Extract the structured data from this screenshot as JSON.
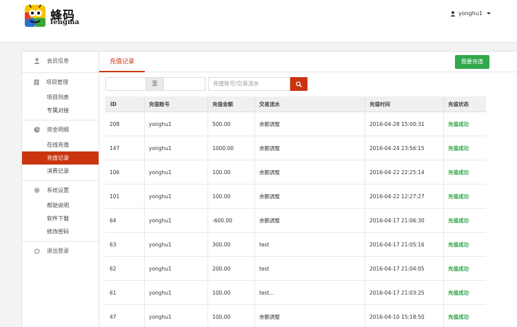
{
  "brand": {
    "name_cn": "蜂码",
    "name_en": "fengma"
  },
  "user": {
    "name": "yonghu1"
  },
  "sidebar": {
    "groups": [
      {
        "icon": "user-icon",
        "label": "会员信息",
        "items": []
      },
      {
        "icon": "document-icon",
        "label": "项目管理",
        "items": [
          "项目列表",
          "专属对接"
        ]
      },
      {
        "icon": "pie-chart-icon",
        "label": "资金明细",
        "items": [
          "在线充值",
          "充值记录",
          "消费记录"
        ]
      },
      {
        "icon": "gear-icon",
        "label": "系统设置",
        "items": [
          "帮助说明",
          "软件下载",
          "修改密码"
        ]
      }
    ],
    "logout": "退出登录",
    "active_item": "充值记录"
  },
  "tab": {
    "label": "充值记录"
  },
  "recharge_button": "我要充值",
  "filters": {
    "to_label": "至",
    "search_placeholder": "充值账号/交易流水"
  },
  "table": {
    "headers": [
      "ID",
      "充值账号",
      "充值金额",
      "交易流水",
      "充值时间",
      "充值状态"
    ],
    "rows": [
      [
        "208",
        "yonghu1",
        "500.00",
        "余额调整",
        "2016-04-28 15:00:31",
        "充值成功"
      ],
      [
        "147",
        "yonghu1",
        "1000.00",
        "余额调整",
        "2016-04-24 23:56:15",
        "充值成功"
      ],
      [
        "106",
        "yonghu1",
        "100.00",
        "余额调整",
        "2016-04-22 22:25:14",
        "充值成功"
      ],
      [
        "101",
        "yonghu1",
        "100.00",
        "余额调整",
        "2016-04-22 12:27:27",
        "充值成功"
      ],
      [
        "64",
        "yonghu1",
        "-600.00",
        "余额调整",
        "2016-04-17 21:06:30",
        "充值成功"
      ],
      [
        "63",
        "yonghu1",
        "300.00",
        "test",
        "2016-04-17 21:05:16",
        "充值成功"
      ],
      [
        "62",
        "yonghu1",
        "200.00",
        "test",
        "2016-04-17 21:04:05",
        "充值成功"
      ],
      [
        "61",
        "yonghu1",
        "100.00",
        "test...",
        "2016-04-17 21:03:25",
        "充值成功"
      ],
      [
        "47",
        "yonghu1",
        "100.00",
        "余额调整",
        "2016-04-10 15:18:50",
        "充值成功"
      ]
    ]
  },
  "colors": {
    "accent": "#c9350f",
    "success": "#2fa94b"
  }
}
